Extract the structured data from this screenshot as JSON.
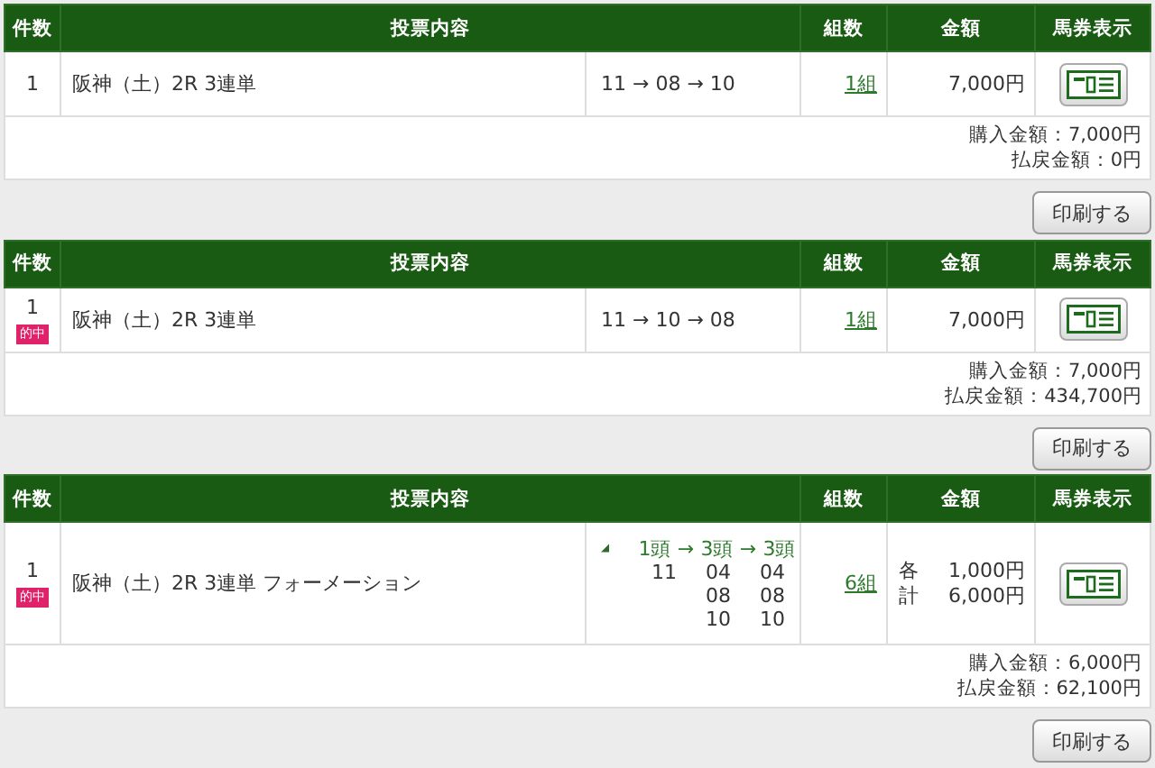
{
  "bets": [
    {
      "columns": [
        "件数",
        "投票内容",
        "組数",
        "金額",
        "馬券表示"
      ],
      "number": "1",
      "race": "阪神（土）2R  3連単",
      "kind": "simple",
      "combination": "11 → 08 → 10",
      "sets": "1組",
      "amount": "7,000円",
      "purchase": "購入金額：7,000円",
      "payout": "払戻金額：0円",
      "print": "印刷する"
    },
    {
      "columns": [
        "件数",
        "投票内容",
        "組数",
        "金額",
        "馬券表示"
      ],
      "number": "1",
      "badge": "的中",
      "race": "阪神（土）2R  3連単",
      "kind": "simple",
      "combination": "11 → 10 → 08",
      "sets": "1組",
      "amount": "7,000円",
      "purchase": "購入金額：7,000円",
      "payout": "払戻金額：434,700円",
      "print": "印刷する"
    },
    {
      "columns": [
        "件数",
        "投票内容",
        "組数",
        "金額",
        "馬券表示"
      ],
      "number": "1",
      "badge": "的中",
      "race": "阪神（土）2R  3連単  フォーメーション",
      "kind": "formation",
      "formation": {
        "heads": [
          "1頭",
          "→",
          "3頭",
          "→",
          "3頭"
        ],
        "legs": [
          [
            "11"
          ],
          [
            "04",
            "08",
            "10"
          ],
          [
            "04",
            "08",
            "10"
          ]
        ]
      },
      "sets": "6組",
      "amount_lines": [
        {
          "label": "各",
          "value": "1,000円"
        },
        {
          "label": "計",
          "value": "6,000円"
        }
      ],
      "purchase": "購入金額：6,000円",
      "payout": "払戻金額：62,100円",
      "print": "印刷する"
    }
  ]
}
